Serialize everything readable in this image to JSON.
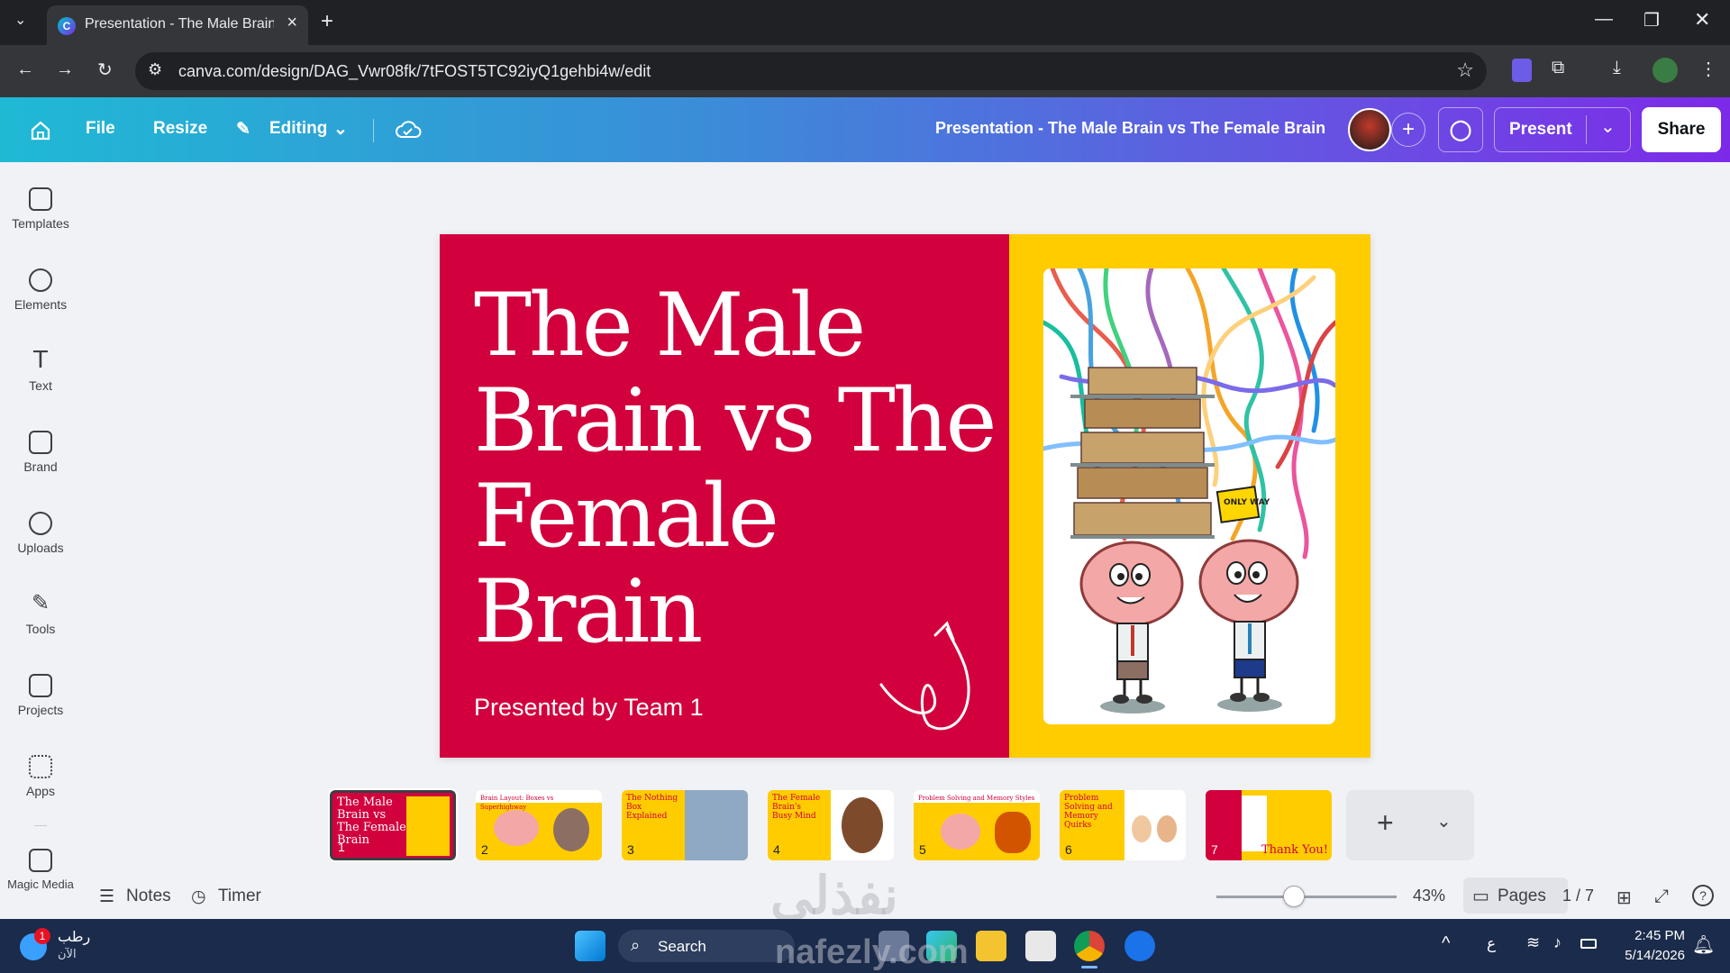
{
  "browser": {
    "tab_title": "Presentation - The Male Brain v",
    "url": "canva.com/design/DAG_Vwr08fk/7tFOST5TC92iyQ1gehbi4w/edit"
  },
  "header": {
    "file": "File",
    "resize": "Resize",
    "editing": "Editing",
    "doc_title": "Presentation - The Male Brain vs The Female Brain",
    "present": "Present",
    "share": "Share"
  },
  "sidebar": {
    "items": [
      {
        "label": "Templates"
      },
      {
        "label": "Elements"
      },
      {
        "label": "Text"
      },
      {
        "label": "Brand"
      },
      {
        "label": "Uploads"
      },
      {
        "label": "Tools"
      },
      {
        "label": "Projects"
      },
      {
        "label": "Apps"
      },
      {
        "label": "Magic Media"
      }
    ]
  },
  "slide": {
    "title": "The Male Brain vs The Female Brain",
    "subtitle": "Presented by Team 1",
    "sign_text": "ONLY WAY"
  },
  "thumbnails": [
    {
      "num": "1",
      "title": "The Male Brain vs The Female Brain"
    },
    {
      "num": "2",
      "title": "Brain Layout: Boxes vs Superhighway"
    },
    {
      "num": "3",
      "title": "The Nothing Box Explained"
    },
    {
      "num": "4",
      "title": "The Female Brain's Busy Mind"
    },
    {
      "num": "5",
      "title": "Problem Solving and Memory Styles"
    },
    {
      "num": "6",
      "title": "Problem Solving and Memory Quirks"
    },
    {
      "num": "7",
      "title": "Thank You!"
    }
  ],
  "footer": {
    "notes": "Notes",
    "timer": "Timer",
    "zoom": "43%",
    "zoom_level": 0.43,
    "pages": "Pages",
    "page_count": "1 / 7"
  },
  "taskbar": {
    "weather": "رطب",
    "weather_sub": "الآن",
    "badge": "1",
    "search": "Search",
    "lang": "ع",
    "time": "2:45 PM",
    "date": "5/14/2026"
  },
  "watermark": {
    "arabic": "نفذلي",
    "latin": "nafezly.com"
  },
  "colors": {
    "slide_red": "#d2003c",
    "slide_yellow": "#ffcc00",
    "header_start": "#1fb9d4",
    "header_end": "#7d2ae8"
  }
}
